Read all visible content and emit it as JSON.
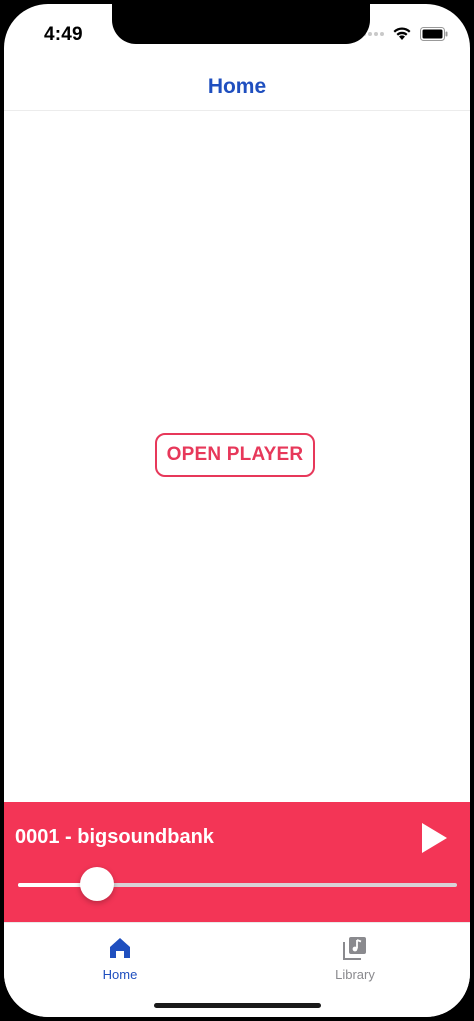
{
  "status_bar": {
    "time": "4:49"
  },
  "header": {
    "title": "Home"
  },
  "main": {
    "open_player_label": "OPEN PLAYER"
  },
  "mini_player": {
    "track_title": "0001 - bigsoundbank",
    "progress": 0.18,
    "background_color": "#f33556"
  },
  "tabs": [
    {
      "label": "Home",
      "icon": "home-icon",
      "active": true
    },
    {
      "label": "Library",
      "icon": "music-library-icon",
      "active": false
    }
  ],
  "colors": {
    "accent": "#1f4fbf",
    "player_accent": "#e7385a",
    "inactive": "#8a8a8e"
  }
}
